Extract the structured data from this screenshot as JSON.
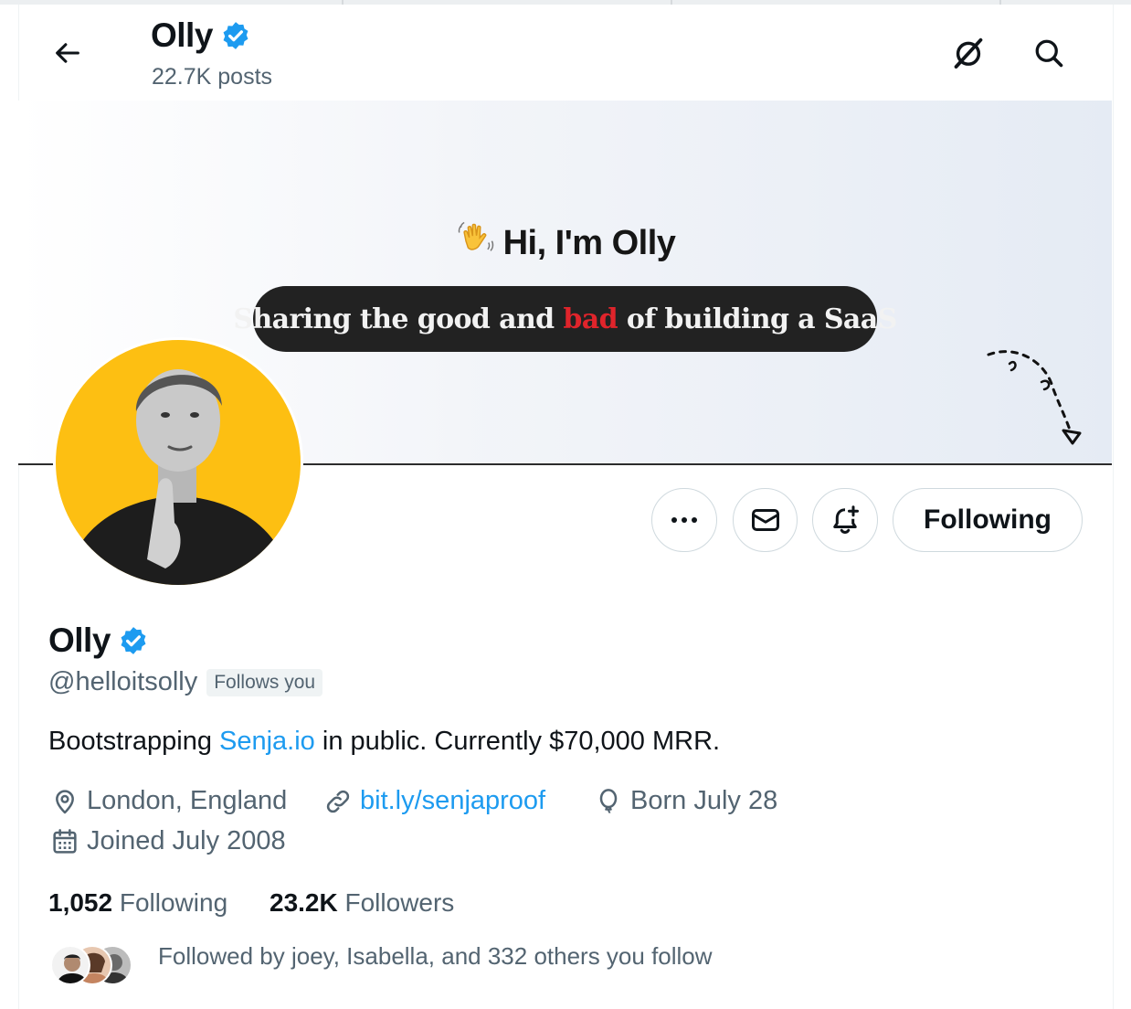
{
  "header": {
    "name": "Olly",
    "posts": "22.7K posts"
  },
  "banner": {
    "hi_text": "Hi, I'm Olly",
    "tagline_part1": "Sharing the good and ",
    "tagline_red": "bad",
    "tagline_part2": " of building a SaaS"
  },
  "actions": {
    "following_label": "Following"
  },
  "profile": {
    "name": "Olly",
    "handle": "@helloitsolly",
    "follows_you": "Follows you",
    "bio_before": "Bootstrapping ",
    "bio_link": "Senja.io",
    "bio_after": " in public. Currently $70,000 MRR.",
    "location": "London, England",
    "website": "bit.ly/senjaproof",
    "birthday": "Born July 28",
    "joined": "Joined July 2008"
  },
  "stats": {
    "following_count": "1,052",
    "following_label": "Following",
    "followers_count": "23.2K",
    "followers_label": "Followers"
  },
  "followed_by": "Followed by joey, Isabella, and 332 others you follow",
  "colors": {
    "accent": "#1d9bf0",
    "verified": "#1d9bf0",
    "avatar_bg": "#fdbf12",
    "pill_bg": "#222222",
    "tagline_red": "#e0242b"
  }
}
